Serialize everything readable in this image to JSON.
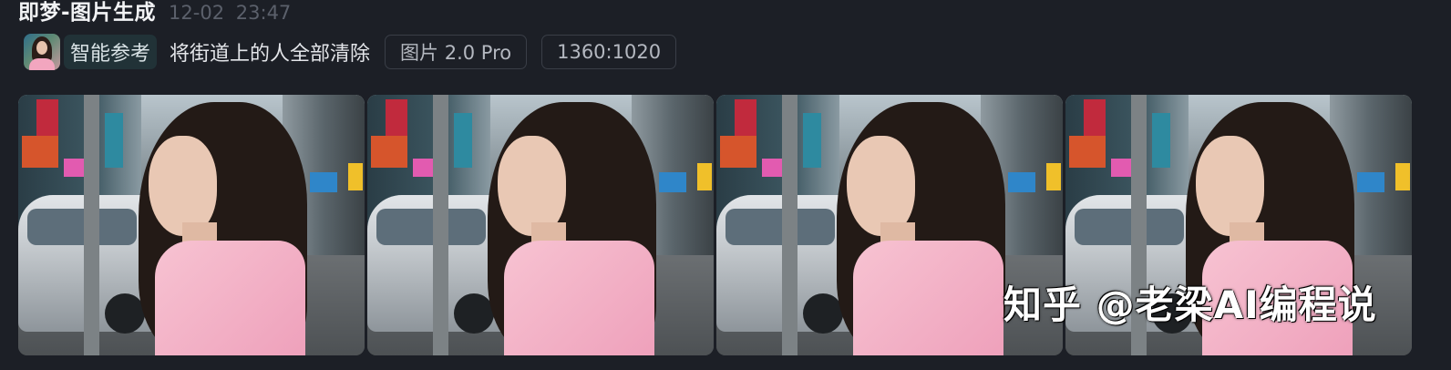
{
  "header": {
    "title": "即梦-图片生成",
    "date": "12-02",
    "time": "23:47"
  },
  "prompt": {
    "tag": "智能参考",
    "text": "将街道上的人全部清除",
    "model": "图片 2.0 Pro",
    "ratio": "1360:1020"
  },
  "gallery": {
    "images": [
      {
        "icon": "generated-image"
      },
      {
        "icon": "generated-image"
      },
      {
        "icon": "generated-image"
      },
      {
        "icon": "generated-image"
      }
    ]
  },
  "watermark": "知乎 @老梁AI编程说"
}
